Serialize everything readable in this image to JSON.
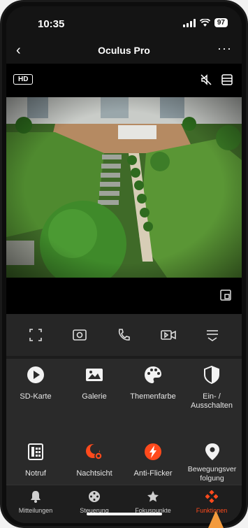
{
  "status_bar": {
    "time": "10:35",
    "battery": "97"
  },
  "nav": {
    "title": "Oculus Pro"
  },
  "video": {
    "quality_badge": "HD"
  },
  "functions": [
    {
      "label": "SD-Karte",
      "icon": "play-icon"
    },
    {
      "label": "Galerie",
      "icon": "gallery-icon"
    },
    {
      "label": "Themenfarbe",
      "icon": "palette-icon"
    },
    {
      "label": "Ein- / Ausschalten",
      "icon": "power-shield-icon"
    },
    {
      "label": "Notruf",
      "icon": "emergency-phone-icon"
    },
    {
      "label": "Nachtsicht",
      "icon": "night-vision-icon"
    },
    {
      "label": "Anti-Flicker",
      "icon": "anti-flicker-icon"
    },
    {
      "label": "Bewegungsverfolgung",
      "icon": "location-pin-icon"
    }
  ],
  "tabs": [
    {
      "label": "Mitteilungen",
      "icon": "bell-icon"
    },
    {
      "label": "Steuerung",
      "icon": "joystick-icon"
    },
    {
      "label": "Fokuspunkte",
      "icon": "star-icon"
    },
    {
      "label": "Funktionen",
      "icon": "functions-icon",
      "active": true
    }
  ],
  "colors": {
    "accent": "#ff4a1c",
    "background": "#242424",
    "pointer": "#f39a3c"
  }
}
